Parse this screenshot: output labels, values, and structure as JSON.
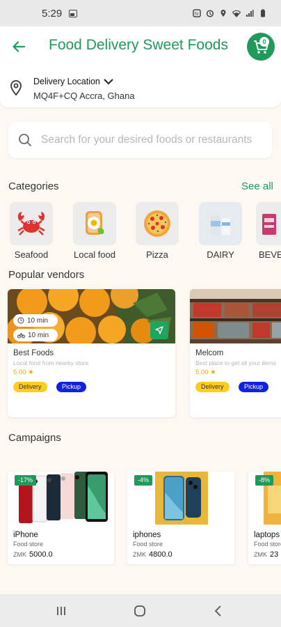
{
  "status_bar": {
    "time": "5:29"
  },
  "header": {
    "title": "Food Delivery Sweet Foods",
    "cart_count": "0"
  },
  "location": {
    "title": "Delivery Location",
    "address": "MQ4F+CQ Accra, Ghana"
  },
  "search": {
    "placeholder": "Search for your desired foods or restaurants"
  },
  "categories": {
    "heading": "Categories",
    "see_all": "See all",
    "items": [
      {
        "label": "Seafood",
        "icon": "crab-icon"
      },
      {
        "label": "Local food",
        "icon": "local-food-icon"
      },
      {
        "label": "Pizza",
        "icon": "pizza-icon"
      },
      {
        "label": "DAIRY",
        "icon": "dairy-icon"
      },
      {
        "label": "BEVER",
        "icon": "beverage-icon"
      }
    ]
  },
  "vendors": {
    "heading": "Popular vendors",
    "items": [
      {
        "name": "Best Foods",
        "description": "Local food from nearby store",
        "rating": "5.00 ★",
        "times": [
          "10 min",
          "10 min"
        ],
        "tags": [
          "Delivery",
          "Pickup"
        ]
      },
      {
        "name": "Melcom",
        "description": "Best place to get all your items",
        "rating": "5.00 ★",
        "tags": [
          "Delivery",
          "Pickup"
        ]
      }
    ]
  },
  "campaigns": {
    "heading": "Campaigns",
    "items": [
      {
        "discount": "-17%",
        "name": "iPhone",
        "store": "Food store",
        "currency": "ZMK",
        "price": "5000.0"
      },
      {
        "discount": "-4%",
        "name": "iphones",
        "store": "Food store",
        "currency": "ZMK",
        "price": "4800.0"
      },
      {
        "discount": "-8%",
        "name": "laptops",
        "store": "Food store",
        "currency": "ZMK",
        "price": "23"
      }
    ]
  },
  "colors": {
    "brand": "#1e9a5a",
    "delivery": "#ffcc1f",
    "pickup": "#1122dd"
  }
}
